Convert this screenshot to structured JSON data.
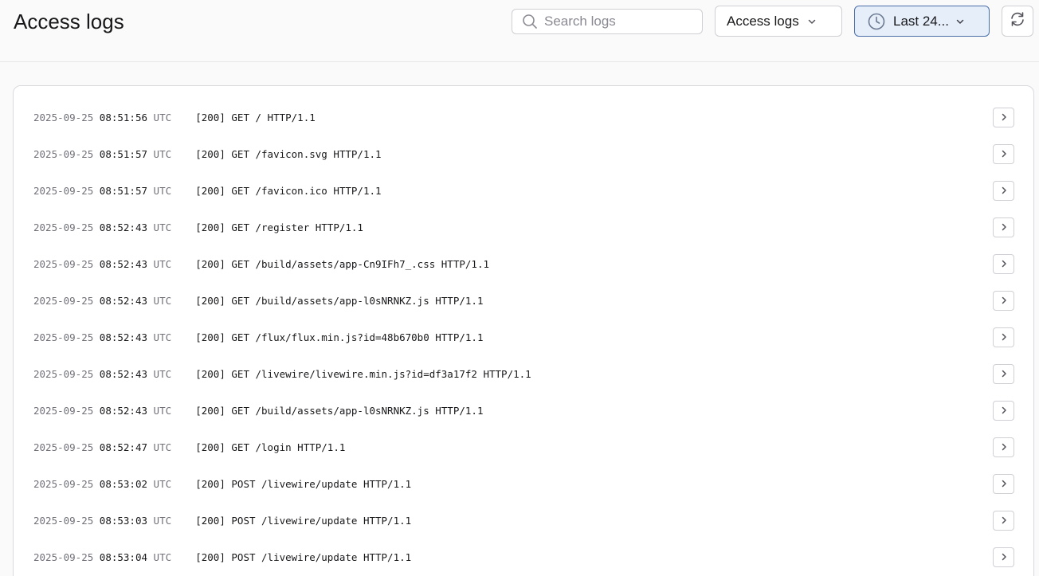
{
  "header": {
    "title": "Access logs",
    "search_placeholder": "Search logs",
    "log_type_label": "Access logs",
    "time_range_label": "Last 24...",
    "refresh_icon": "refresh-icon",
    "accent_color": "#4b6ea8"
  },
  "logs": [
    {
      "date": "2025-09-25",
      "time": "08:51:56",
      "tz": "UTC",
      "message": "[200] GET / HTTP/1.1"
    },
    {
      "date": "2025-09-25",
      "time": "08:51:57",
      "tz": "UTC",
      "message": "[200] GET /favicon.svg HTTP/1.1"
    },
    {
      "date": "2025-09-25",
      "time": "08:51:57",
      "tz": "UTC",
      "message": "[200] GET /favicon.ico HTTP/1.1"
    },
    {
      "date": "2025-09-25",
      "time": "08:52:43",
      "tz": "UTC",
      "message": "[200] GET /register HTTP/1.1"
    },
    {
      "date": "2025-09-25",
      "time": "08:52:43",
      "tz": "UTC",
      "message": "[200] GET /build/assets/app-Cn9IFh7_.css HTTP/1.1"
    },
    {
      "date": "2025-09-25",
      "time": "08:52:43",
      "tz": "UTC",
      "message": "[200] GET /build/assets/app-l0sNRNKZ.js HTTP/1.1"
    },
    {
      "date": "2025-09-25",
      "time": "08:52:43",
      "tz": "UTC",
      "message": "[200] GET /flux/flux.min.js?id=48b670b0 HTTP/1.1"
    },
    {
      "date": "2025-09-25",
      "time": "08:52:43",
      "tz": "UTC",
      "message": "[200] GET /livewire/livewire.min.js?id=df3a17f2 HTTP/1.1"
    },
    {
      "date": "2025-09-25",
      "time": "08:52:43",
      "tz": "UTC",
      "message": "[200] GET /build/assets/app-l0sNRNKZ.js HTTP/1.1"
    },
    {
      "date": "2025-09-25",
      "time": "08:52:47",
      "tz": "UTC",
      "message": "[200] GET /login HTTP/1.1"
    },
    {
      "date": "2025-09-25",
      "time": "08:53:02",
      "tz": "UTC",
      "message": "[200] POST /livewire/update HTTP/1.1"
    },
    {
      "date": "2025-09-25",
      "time": "08:53:03",
      "tz": "UTC",
      "message": "[200] POST /livewire/update HTTP/1.1"
    },
    {
      "date": "2025-09-25",
      "time": "08:53:04",
      "tz": "UTC",
      "message": "[200] POST /livewire/update HTTP/1.1"
    }
  ]
}
